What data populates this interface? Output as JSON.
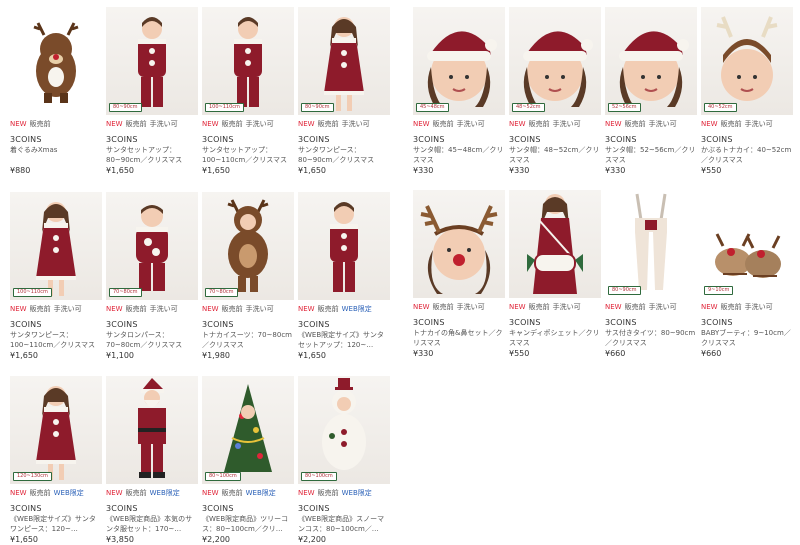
{
  "colors": {
    "accent_new": "#e0263a",
    "web_tag": "#2c62b8",
    "badge_border": "#2f6a3d",
    "costume_red": "#8e1b2b"
  },
  "left_grid": [
    {
      "image": "reindeer-plush",
      "badge": "",
      "tags": [
        "NEW",
        "販売前"
      ],
      "brand": "3COINS",
      "name": "着ぐるみXmas",
      "price": "¥880"
    },
    {
      "image": "santa-setup-child",
      "badge": "80~90cm",
      "tags": [
        "NEW",
        "販売前",
        "手洗い可"
      ],
      "brand": "3COINS",
      "name": "サンタセットアップ：80~90cm／クリスマス",
      "price": "¥1,650"
    },
    {
      "image": "santa-setup-child",
      "badge": "100~110cm",
      "tags": [
        "NEW",
        "販売前",
        "手洗い可"
      ],
      "brand": "3COINS",
      "name": "サンタセットアップ：100~110cm／クリスマス",
      "price": "¥1,650"
    },
    {
      "image": "santa-dress-child",
      "badge": "80~90cm",
      "tags": [
        "NEW",
        "販売前",
        "手洗い可"
      ],
      "brand": "3COINS",
      "name": "サンタワンピース：80~90cm／クリスマス",
      "price": "¥1,650"
    },
    {
      "image": "santa-dress-girl",
      "badge": "100~110cm",
      "tags": [
        "NEW",
        "販売前",
        "手洗い可"
      ],
      "brand": "3COINS",
      "name": "サンタワンピース：100~110cm／クリスマス",
      "price": "¥1,650"
    },
    {
      "image": "santa-rompers",
      "badge": "70~80cm",
      "tags": [
        "NEW",
        "販売前",
        "手洗い可"
      ],
      "brand": "3COINS",
      "name": "サンタロンパース：70~80cm／クリスマス",
      "price": "¥1,100"
    },
    {
      "image": "reindeer-costume",
      "badge": "70~80cm",
      "tags": [
        "NEW",
        "販売前",
        "手洗い可"
      ],
      "brand": "3COINS",
      "name": "トナカイスーツ：70~80cm／クリスマス",
      "price": "¥1,980"
    },
    {
      "image": "santa-setup-child",
      "badge": "",
      "tags": [
        "NEW",
        "販売前",
        "WEB限定"
      ],
      "brand": "3COINS",
      "name": "《WEB限定サイズ》サンタセットアップ：120~…",
      "price": "¥1,650"
    },
    {
      "image": "santa-dress-girl",
      "badge": "120~130cm",
      "tags": [
        "NEW",
        "販売前",
        "WEB限定"
      ],
      "brand": "3COINS",
      "name": "《WEB限定サイズ》サンタワンピース：120~…",
      "price": "¥1,650"
    },
    {
      "image": "santa-suit-adult",
      "badge": "",
      "tags": [
        "NEW",
        "販売前",
        "WEB限定"
      ],
      "brand": "3COINS",
      "name": "《WEB限定商品》本気のサンタ服セット：170~…",
      "price": "¥3,850"
    },
    {
      "image": "tree-costume",
      "badge": "80~100cm",
      "tags": [
        "NEW",
        "販売前",
        "WEB限定"
      ],
      "brand": "3COINS",
      "name": "《WEB限定商品》ツリーコス：80~100cm／クリ…",
      "price": "¥2,200"
    },
    {
      "image": "snowman-costume",
      "badge": "80~100cm",
      "tags": [
        "NEW",
        "販売前",
        "WEB限定"
      ],
      "brand": "3COINS",
      "name": "《WEB限定商品》スノーマンコス：80~100cm／…",
      "price": "¥2,200"
    }
  ],
  "right_grid": [
    {
      "image": "santa-hat-kid",
      "badge": "45~48cm",
      "tags": [
        "NEW",
        "販売前",
        "手洗い可"
      ],
      "brand": "3COINS",
      "name": "サンタ帽：45~48cm／クリスマス",
      "price": "¥330"
    },
    {
      "image": "santa-hat-kid",
      "badge": "48~52cm",
      "tags": [
        "NEW",
        "販売前",
        "手洗い可"
      ],
      "brand": "3COINS",
      "name": "サンタ帽：48~52cm／クリスマス",
      "price": "¥330"
    },
    {
      "image": "santa-hat-kid",
      "badge": "52~56cm",
      "tags": [
        "NEW",
        "販売前",
        "手洗い可"
      ],
      "brand": "3COINS",
      "name": "サンタ帽：52~56cm／クリスマス",
      "price": "¥330"
    },
    {
      "image": "reindeer-hat-kid",
      "badge": "40~52cm",
      "tags": [
        "NEW",
        "販売前",
        "手洗い可"
      ],
      "brand": "3COINS",
      "name": "かぶるトナカイ：40~52cm／クリスマス",
      "price": "¥550"
    },
    {
      "image": "antler-headband",
      "badge": "",
      "tags": [
        "NEW",
        "販売前",
        "手洗い可"
      ],
      "brand": "3COINS",
      "name": "トナカイの角&鼻セット／クリスマス",
      "price": "¥330"
    },
    {
      "image": "candy-pochette",
      "badge": "",
      "tags": [
        "NEW",
        "販売前",
        "手洗い可"
      ],
      "brand": "3COINS",
      "name": "キャンディポシェット／クリスマス",
      "price": "¥550"
    },
    {
      "image": "tights",
      "badge": "80~90cm",
      "tags": [
        "NEW",
        "販売前",
        "手洗い可"
      ],
      "brand": "3COINS",
      "name": "サス付きタイツ：80~90cm／クリスマス",
      "price": "¥660"
    },
    {
      "image": "reindeer-booties",
      "badge": "9~10cm",
      "tags": [
        "NEW",
        "販売前",
        "手洗い可"
      ],
      "brand": "3COINS",
      "name": "BABYブーティ：9~10cm／クリスマス",
      "price": "¥660"
    }
  ]
}
